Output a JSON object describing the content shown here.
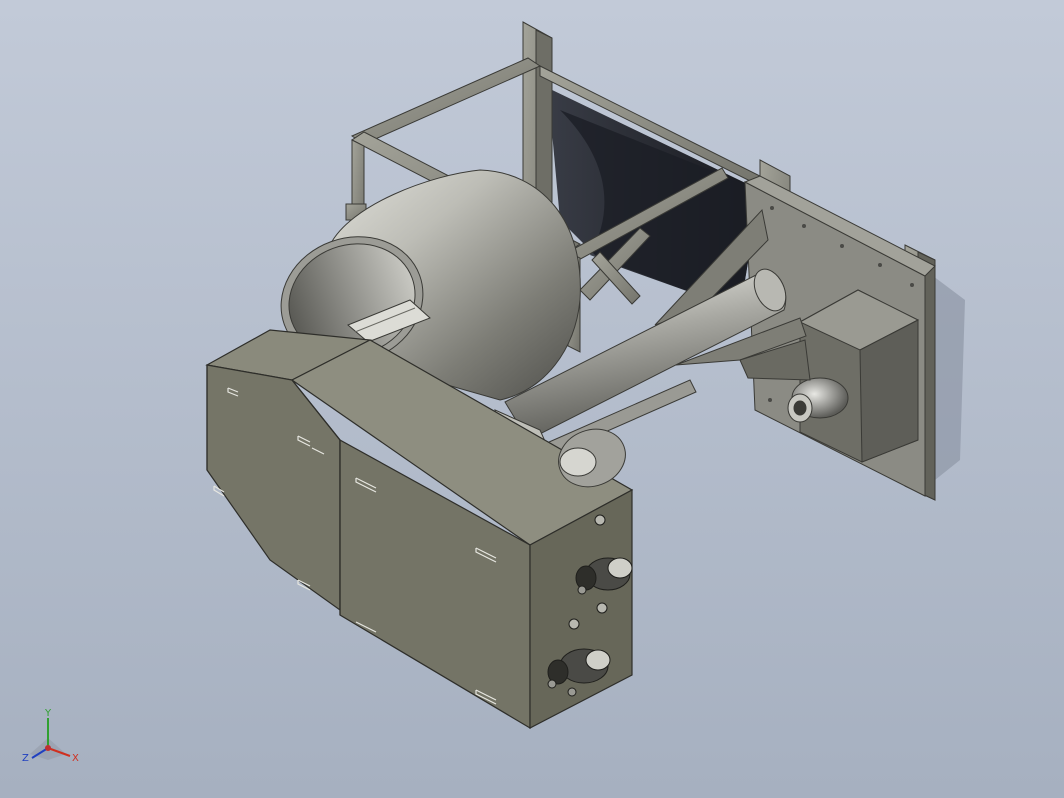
{
  "viewport": {
    "background_top": "#c2cad8",
    "background_bottom": "#a6b0c0"
  },
  "model": {
    "body_color": "#7a7a6c",
    "frame_color": "#8a8a80",
    "drum_color": "#9a9a92",
    "edge_color": "#3a3a36"
  },
  "triad": {
    "x_label": "X",
    "y_label": "Y",
    "z_label": "Z",
    "x_color": "#d03020",
    "y_color": "#30a030",
    "z_color": "#2040c0"
  }
}
